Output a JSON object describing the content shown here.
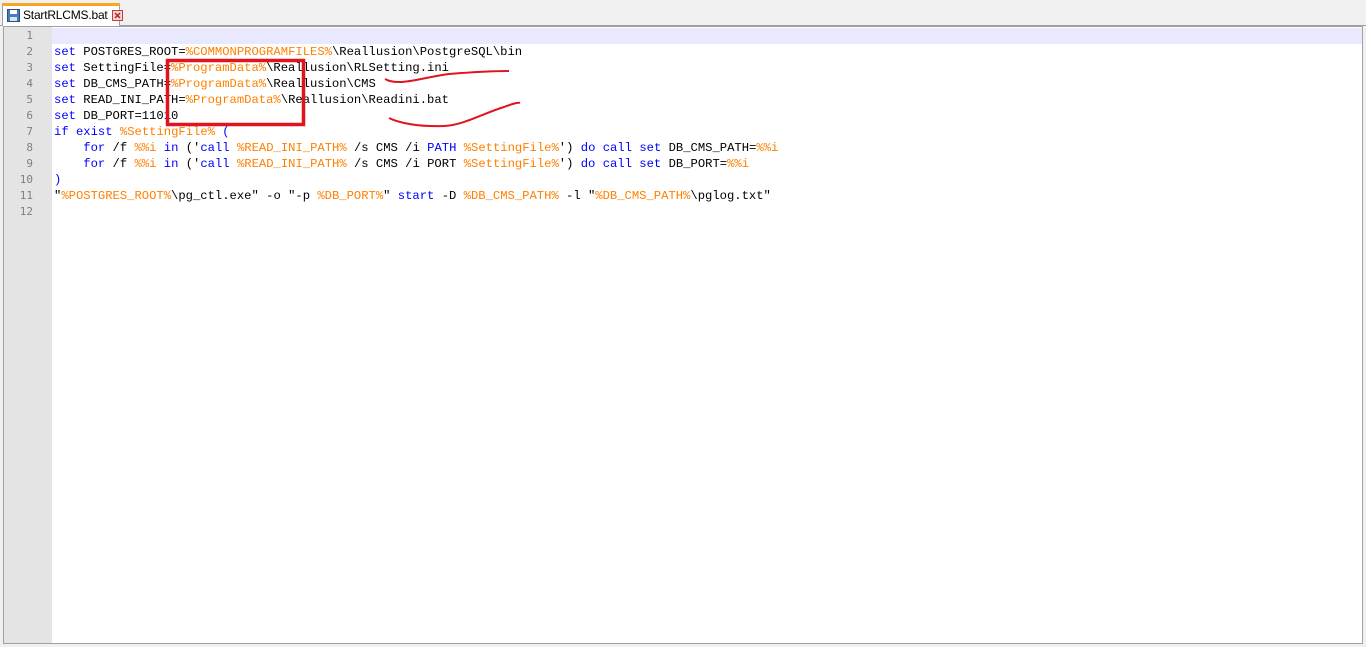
{
  "tab": {
    "title": "StartRLCMS.bat",
    "save_icon": "floppy-save-icon",
    "close_icon": "close-x-icon"
  },
  "colors": {
    "keyword": "#0000ff",
    "variable": "#ff8000",
    "text": "#000000",
    "gutter": "#e4e4e4",
    "current_line": "#e8e8ff",
    "annotation": "#e0141e"
  },
  "line_numbers": [
    "1",
    "2",
    "3",
    "4",
    "5",
    "6",
    "7",
    "8",
    "9",
    "10",
    "11",
    "12"
  ],
  "lines": [
    [],
    [
      {
        "t": "set",
        "c": "kw"
      },
      {
        "t": " POSTGRES_ROOT=",
        "c": ""
      },
      {
        "t": "%COMMONPROGRAMFILES%",
        "c": "var"
      },
      {
        "t": "\\Reallusion\\PostgreSQL\\bin",
        "c": ""
      }
    ],
    [
      {
        "t": "set",
        "c": "kw"
      },
      {
        "t": " SettingFile=",
        "c": ""
      },
      {
        "t": "%ProgramData%",
        "c": "var"
      },
      {
        "t": "\\Reallusion\\RLSetting.ini",
        "c": ""
      }
    ],
    [
      {
        "t": "set",
        "c": "kw"
      },
      {
        "t": " DB_CMS_PATH=",
        "c": ""
      },
      {
        "t": "%ProgramData%",
        "c": "var"
      },
      {
        "t": "\\Reallusion\\CMS",
        "c": ""
      }
    ],
    [
      {
        "t": "set",
        "c": "kw"
      },
      {
        "t": " READ_INI_PATH=",
        "c": ""
      },
      {
        "t": "%ProgramData%",
        "c": "var"
      },
      {
        "t": "\\Reallusion\\Readini.bat",
        "c": ""
      }
    ],
    [
      {
        "t": "set",
        "c": "kw"
      },
      {
        "t": " DB_PORT=11010",
        "c": ""
      }
    ],
    [
      {
        "t": "if",
        "c": "kw"
      },
      {
        "t": " ",
        "c": ""
      },
      {
        "t": "exist",
        "c": "kw"
      },
      {
        "t": " ",
        "c": ""
      },
      {
        "t": "%SettingFile%",
        "c": "var"
      },
      {
        "t": " (",
        "c": "kw"
      }
    ],
    [
      {
        "t": "    ",
        "c": ""
      },
      {
        "t": "for",
        "c": "kw"
      },
      {
        "t": " /f ",
        "c": ""
      },
      {
        "t": "%%i",
        "c": "var"
      },
      {
        "t": " ",
        "c": ""
      },
      {
        "t": "in",
        "c": "kw"
      },
      {
        "t": " ('",
        "c": ""
      },
      {
        "t": "call",
        "c": "kw"
      },
      {
        "t": " ",
        "c": ""
      },
      {
        "t": "%READ_INI_PATH%",
        "c": "var"
      },
      {
        "t": " /s CMS /i ",
        "c": ""
      },
      {
        "t": "PATH",
        "c": "kw"
      },
      {
        "t": " ",
        "c": ""
      },
      {
        "t": "%SettingFile%",
        "c": "var"
      },
      {
        "t": "') ",
        "c": ""
      },
      {
        "t": "do",
        "c": "kw"
      },
      {
        "t": " ",
        "c": ""
      },
      {
        "t": "call",
        "c": "kw"
      },
      {
        "t": " ",
        "c": ""
      },
      {
        "t": "set",
        "c": "kw"
      },
      {
        "t": " DB_CMS_PATH=",
        "c": ""
      },
      {
        "t": "%%i",
        "c": "var"
      }
    ],
    [
      {
        "t": "    ",
        "c": ""
      },
      {
        "t": "for",
        "c": "kw"
      },
      {
        "t": " /f ",
        "c": ""
      },
      {
        "t": "%%i",
        "c": "var"
      },
      {
        "t": " ",
        "c": ""
      },
      {
        "t": "in",
        "c": "kw"
      },
      {
        "t": " ('",
        "c": ""
      },
      {
        "t": "call",
        "c": "kw"
      },
      {
        "t": " ",
        "c": ""
      },
      {
        "t": "%READ_INI_PATH%",
        "c": "var"
      },
      {
        "t": " /s CMS /i PORT ",
        "c": ""
      },
      {
        "t": "%SettingFile%",
        "c": "var"
      },
      {
        "t": "') ",
        "c": ""
      },
      {
        "t": "do",
        "c": "kw"
      },
      {
        "t": " ",
        "c": ""
      },
      {
        "t": "call",
        "c": "kw"
      },
      {
        "t": " ",
        "c": ""
      },
      {
        "t": "set",
        "c": "kw"
      },
      {
        "t": " DB_PORT=",
        "c": ""
      },
      {
        "t": "%%i",
        "c": "var"
      }
    ],
    [
      {
        "t": ")",
        "c": "kw"
      }
    ],
    [
      {
        "t": "\"",
        "c": ""
      },
      {
        "t": "%POSTGRES_ROOT%",
        "c": "var"
      },
      {
        "t": "\\pg_ctl.exe\" -o \"-p ",
        "c": ""
      },
      {
        "t": "%DB_PORT%",
        "c": "var"
      },
      {
        "t": "\" ",
        "c": ""
      },
      {
        "t": "start",
        "c": "kw"
      },
      {
        "t": " -D ",
        "c": ""
      },
      {
        "t": "%DB_CMS_PATH%",
        "c": "var"
      },
      {
        "t": " -l \"",
        "c": ""
      },
      {
        "t": "%DB_CMS_PATH%",
        "c": "var"
      },
      {
        "t": "\\pglog.txt\"",
        "c": ""
      }
    ],
    []
  ]
}
